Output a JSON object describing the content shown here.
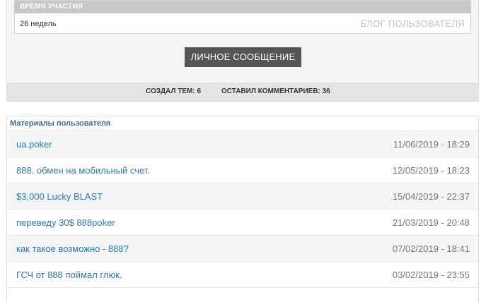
{
  "profile": {
    "tenure_label": "ВРЕМЯ УЧАСТИЯ",
    "tenure_value": "26 недель",
    "blog_link": "БЛОГ ПОЛЬЗОВАТЕЛЯ",
    "message_button": "ЛИЧНОЕ СООБЩЕНИЕ",
    "topics_created": "СОЗДАЛ ТЕМ: 6",
    "comments_left": "ОСТАВИЛ КОММЕНТАРИЕВ: 36"
  },
  "materials": {
    "header": "Материалы пользователя",
    "items": [
      {
        "title": "ua.poker",
        "date": "11/06/2019 - 18:29"
      },
      {
        "title": "888. обмен на мобильный счет.",
        "date": "12/05/2019 - 18:23"
      },
      {
        "title": "$3,000 Lucky BLAST",
        "date": "15/04/2019 - 22:37"
      },
      {
        "title": "переведу 30$ 888poker",
        "date": "21/03/2019 - 20:48"
      },
      {
        "title": "как такое возможно - 888?",
        "date": "07/02/2019 - 18:41"
      },
      {
        "title": "ГСЧ от 888 поймал глюк.",
        "date": "03/02/2019 - 23:55"
      }
    ]
  }
}
